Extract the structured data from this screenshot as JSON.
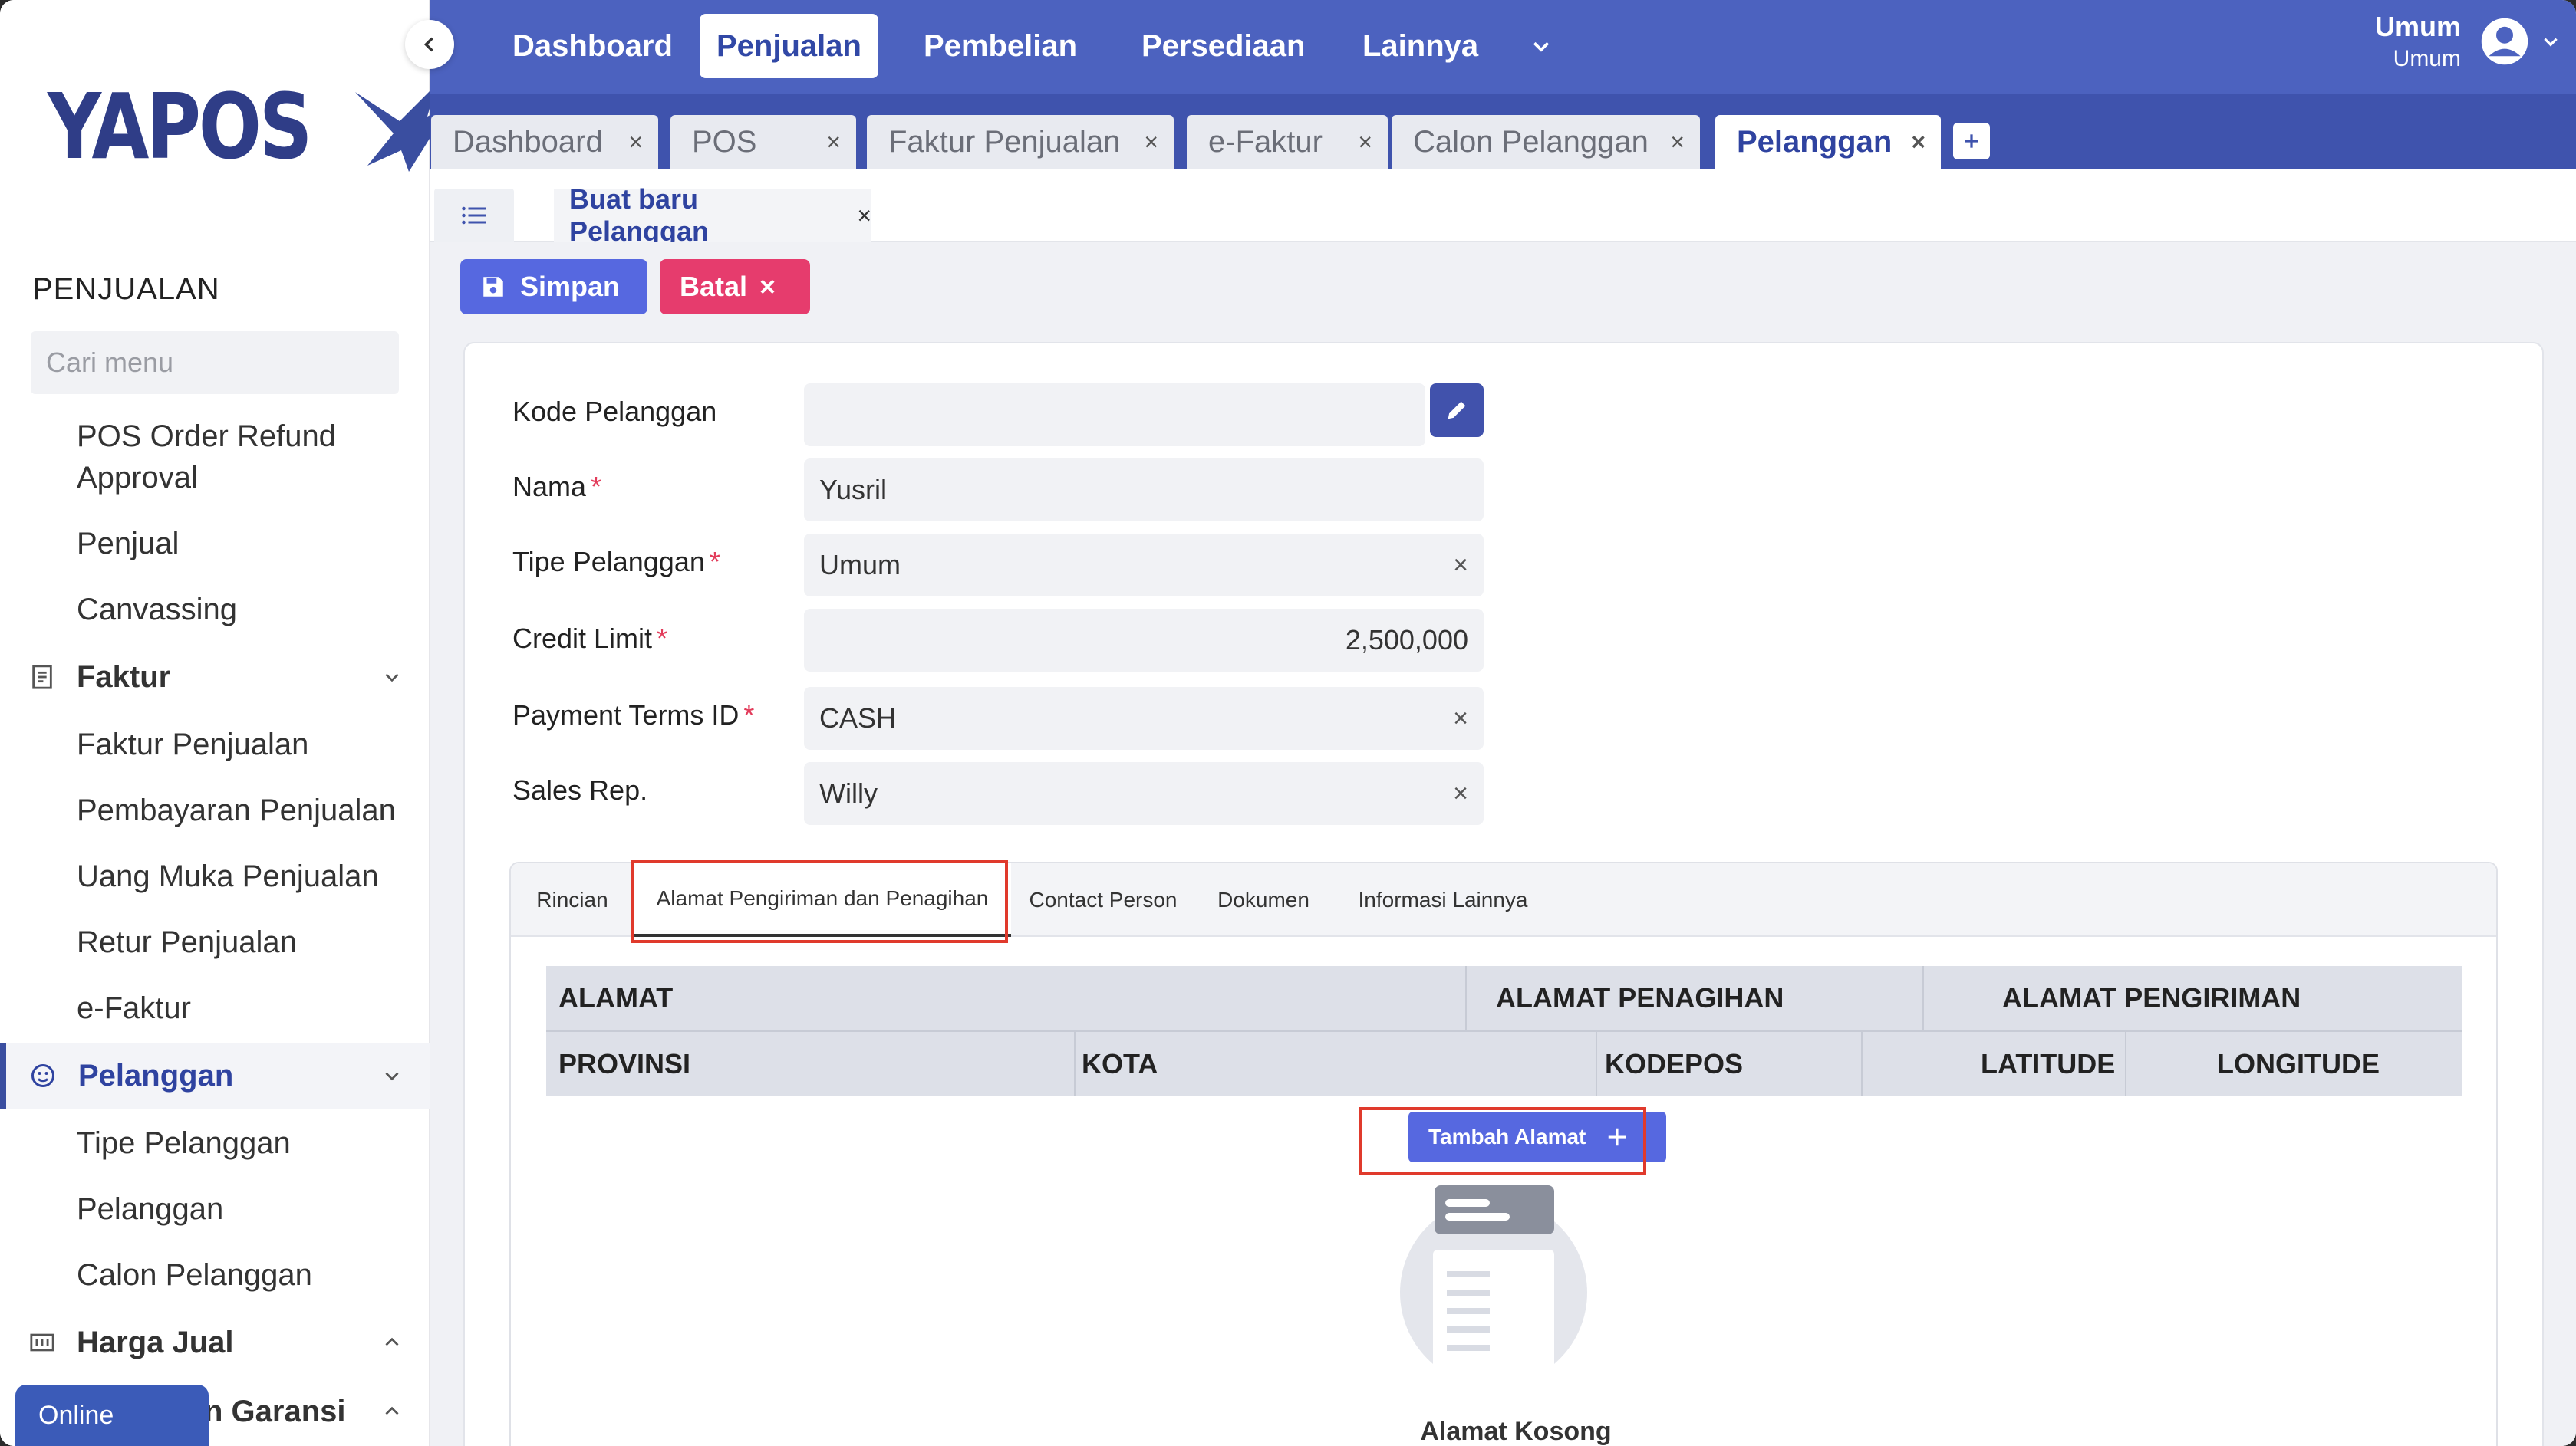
{
  "sidebar": {
    "logo_text": "YAPOS",
    "section_title": "PENJUALAN",
    "search_placeholder": "Cari menu",
    "items_top": [
      "POS Order Refund",
      "Approval",
      "Penjual",
      "Canvassing"
    ],
    "group_faktur": "Faktur",
    "faktur_items": [
      "Faktur Penjualan",
      "Pembayaran Penjualan",
      "Uang Muka Penjualan",
      "Retur Penjualan",
      "e-Faktur"
    ],
    "group_pelanggan": "Pelanggan",
    "pelanggan_items": [
      "Tipe Pelanggan",
      "Pelanggan",
      "Calon Pelanggan"
    ],
    "group_harga": "Harga Jual",
    "group_garansi": "n Garansi",
    "online_label": "Online"
  },
  "topnav": {
    "items": [
      "Dashboard",
      "Penjualan",
      "Pembelian",
      "Persediaan",
      "Lainnya"
    ],
    "user_name": "Umum",
    "user_role": "Umum"
  },
  "page_tabs": [
    "Dashboard",
    "POS",
    "Faktur Penjualan",
    "e-Faktur",
    "Calon Pelanggan",
    "Pelanggan"
  ],
  "subtab": {
    "label": "Buat baru Pelanggan"
  },
  "actions": {
    "save": "Simpan",
    "cancel": "Batal"
  },
  "form": {
    "kode_label": "Kode Pelanggan",
    "kode_value": "",
    "nama_label": "Nama",
    "nama_value": "Yusril",
    "tipe_label": "Tipe Pelanggan",
    "tipe_value": "Umum",
    "credit_label": "Credit Limit",
    "credit_value": "2,500,000",
    "terms_label": "Payment Terms ID",
    "terms_value": "CASH",
    "sales_label": "Sales Rep.",
    "sales_value": "Willy",
    "required_mark": "*"
  },
  "inner_tabs": [
    "Rincian",
    "Alamat Pengiriman dan Penagihan",
    "Contact Person",
    "Dokumen",
    "Informasi Lainnya"
  ],
  "address_table": {
    "headers_row1": [
      "ALAMAT",
      "ALAMAT PENAGIHAN",
      "ALAMAT PENGIRIMAN"
    ],
    "headers_row2": [
      "PROVINSI",
      "KOTA",
      "KODEPOS",
      "LATITUDE",
      "LONGITUDE"
    ],
    "add_button": "Tambah Alamat",
    "empty_text": "Alamat Kosong"
  },
  "colors": {
    "topbar": "#4c62bf",
    "primary": "#5668e0",
    "danger": "#e63c6d",
    "highlight": "#e03a2c"
  }
}
